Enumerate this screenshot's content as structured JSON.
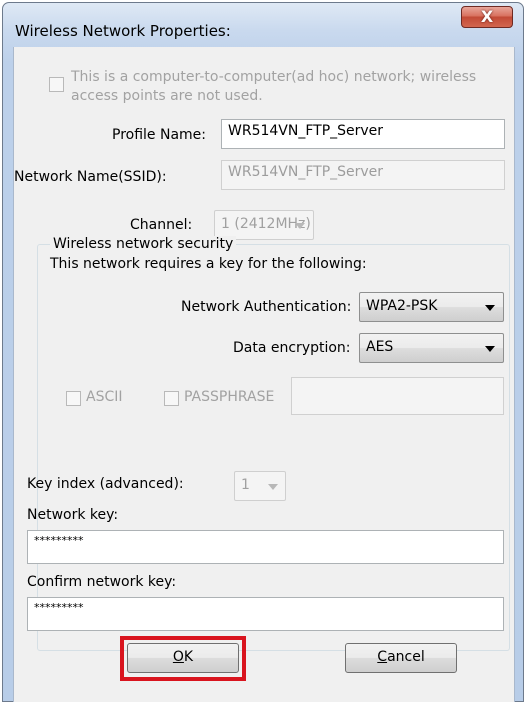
{
  "window": {
    "title": "Wireless Network Properties:",
    "close_glyph": "X"
  },
  "adhoc": {
    "line1": "This is a computer-to-computer(ad hoc) network; wireless",
    "line2": "access points are not used.",
    "checked": false
  },
  "profile": {
    "label": "Profile Name:",
    "value": "WR514VN_FTP_Server"
  },
  "ssid": {
    "label": "Network Name(SSID):",
    "value": "WR514VN_FTP_Server"
  },
  "channel": {
    "label": "Channel:",
    "value": "1 (2412MHz)"
  },
  "security": {
    "group_label": "Wireless network security",
    "requires_text": "This network requires a key for the following:",
    "auth_label": "Network Authentication:",
    "auth_value": "WPA2-PSK",
    "enc_label": "Data encryption:",
    "enc_value": "AES",
    "ascii_label": "ASCII",
    "passphrase_label": "PASSPHRASE",
    "passphrase_value": "",
    "key_index_label": "Key index (advanced):",
    "key_index_value": "1",
    "network_key_label": "Network key:",
    "network_key_value": "*********",
    "confirm_key_label": "Confirm network key:",
    "confirm_key_value": "*********"
  },
  "buttons": {
    "ok_mnemonic": "O",
    "ok_rest": "K",
    "cancel_mnemonic": "C",
    "cancel_rest": "ancel"
  },
  "highlight_color": "#d9141e"
}
